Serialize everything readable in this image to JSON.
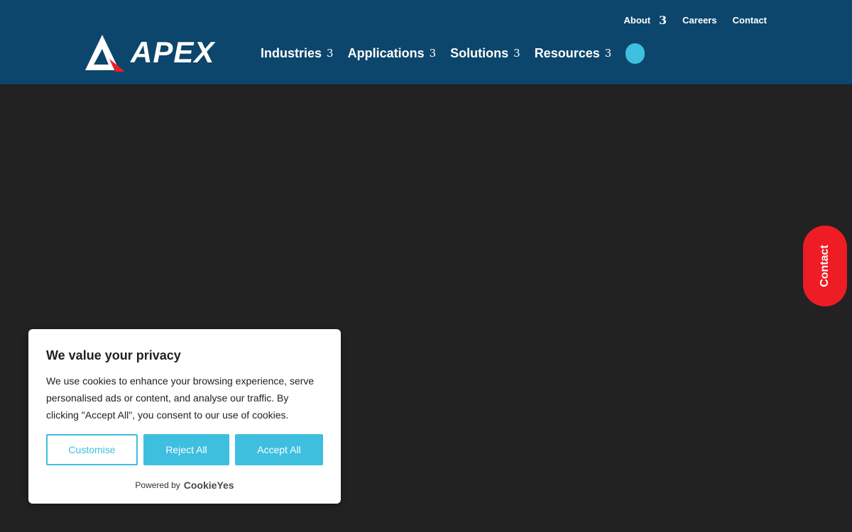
{
  "header": {
    "top_nav": [
      {
        "label": "About",
        "caret": "3"
      },
      {
        "label": "Careers"
      },
      {
        "label": "Contact"
      }
    ],
    "logo_text": "APEX",
    "main_nav": [
      {
        "label": "Industries",
        "caret": "3"
      },
      {
        "label": "Applications",
        "caret": "3"
      },
      {
        "label": "Solutions",
        "caret": "3"
      },
      {
        "label": "Resources",
        "caret": "3"
      }
    ]
  },
  "contact_tab": {
    "label": "Contact"
  },
  "cookie_banner": {
    "title": "We value your privacy",
    "body": "We use cookies to enhance your browsing experience, serve personalised ads or content, and analyse our traffic. By clicking \"Accept All\", you consent to our use of cookies.",
    "customise_label": "Customise",
    "reject_label": "Reject All",
    "accept_label": "Accept All",
    "powered_by": "Powered by",
    "brand": "CookieYes"
  },
  "colors": {
    "header_bg": "#0c466c",
    "page_bg": "#222222",
    "accent": "#3fbfe0",
    "contact_tab": "#ee1c25"
  },
  "icons": {
    "logo_mark": "apex-triangle-logo",
    "search": "search-pill"
  }
}
